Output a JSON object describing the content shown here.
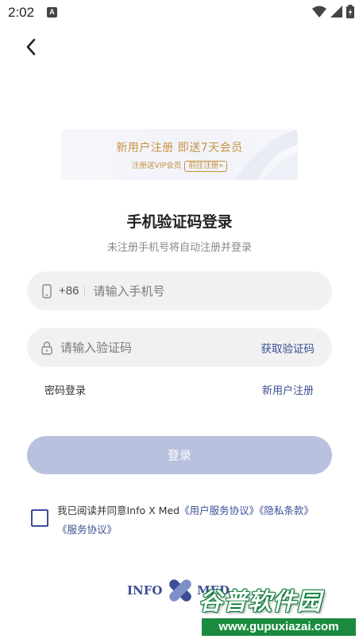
{
  "status_bar": {
    "time": "2:02",
    "notification_badge": "A"
  },
  "promo": {
    "title": "新用户注册  即送7天会员",
    "subtitle": "注册送VIP会员",
    "cta": "前往注册»",
    "color": "#c8923e"
  },
  "login": {
    "title": "手机验证码登录",
    "subtitle": "未注册手机号将自动注册并登录",
    "country_code": "+86",
    "phone_placeholder": "请输入手机号",
    "code_placeholder": "请输入验证码",
    "get_code": "获取验证码",
    "password_login": "密码登录",
    "new_user_register": "新用户注册",
    "login_button": "登录"
  },
  "agreement": {
    "prefix": "我已阅读并同意Info X Med",
    "user_service": "《用户服务协议》",
    "privacy": "《隐私条款》",
    "service": "《服务协议》"
  },
  "brand": {
    "left": "INFO",
    "right": "MED"
  },
  "watermark": {
    "title": "谷普软件园",
    "url": "www.gupuxiazai.com"
  },
  "colors": {
    "accent": "#3b4e94",
    "button_disabled": "#b8c1dd",
    "field_bg": "#f1f1f1"
  }
}
